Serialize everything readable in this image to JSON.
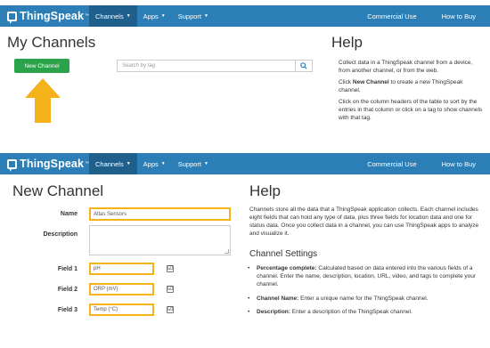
{
  "colors": {
    "navbar": "#2b7fb6",
    "nav_active": "#1f5f8c",
    "new_channel_button": "#2aa34b",
    "highlight": "#f5b21a"
  },
  "top_panel": {
    "nav": {
      "brand": "ThingSpeak",
      "trademark": "™",
      "items": [
        "Channels",
        "Apps",
        "Support"
      ],
      "right_items": [
        "Commercial Use",
        "How to Buy"
      ]
    },
    "title": "My Channels",
    "new_channel_button": "New Channel",
    "search": {
      "placeholder": "Search by tag",
      "icon": "search-icon"
    },
    "help": {
      "title": "Help",
      "p1": "Collect data in a ThingSpeak channel from a device, from another channel, or from the web.",
      "p2_prefix": "Click ",
      "p2_bold": "New Channel",
      "p2_suffix": " to create a new ThingSpeak channel.",
      "p3": "Click on the column headers of the table to sort by the entries in that column or click on a tag to show channels with that tag."
    }
  },
  "bottom_panel": {
    "nav": {
      "brand": "ThingSpeak",
      "trademark": "™",
      "items": [
        "Channels",
        "Apps",
        "Support"
      ],
      "right_items": [
        "Commercial Use",
        "How to Buy"
      ]
    },
    "title": "New Channel",
    "form": {
      "name_label": "Name",
      "name_value": "Atlas Sensors",
      "description_label": "Description",
      "field1_label": "Field 1",
      "field1_value": "pH",
      "field2_label": "Field 2",
      "field2_value": "ORP (mV)",
      "field3_label": "Field 3",
      "field3_value": "Temp (°C)",
      "checkbox_mark": "☑"
    },
    "help": {
      "title": "Help",
      "intro": "Channels store all the data that a ThingSpeak application collects. Each channel includes eight fields that can hold any type of data, plus three fields for location data and one for status data. Once you collect data in a channel, you can use ThingSpeak apps to analyze and visualize it.",
      "settings_title": "Channel Settings",
      "bullets": [
        {
          "bold": "Percentage complete:",
          "text": " Calculated based on data entered into the various fields of a channel. Enter the name, description, location, URL, video, and tags to complete your channel."
        },
        {
          "bold": "Channel Name:",
          "text": " Enter a unique name for the ThingSpeak channel."
        },
        {
          "bold": "Description:",
          "text": " Enter a description of the ThingSpeak channel."
        }
      ]
    }
  }
}
